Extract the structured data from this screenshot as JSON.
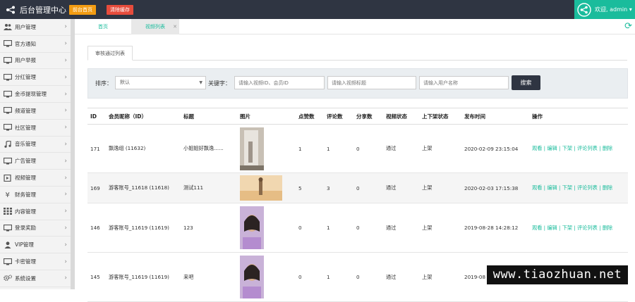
{
  "header": {
    "brand": "后台管理中心",
    "btn_home": "前台首页",
    "btn_cache": "清除缓存",
    "welcome": "欢迎, admin ▾"
  },
  "sidebar": {
    "items": [
      {
        "label": "用户管理",
        "icon": "users-icon"
      },
      {
        "label": "官方通知",
        "icon": "monitor-icon"
      },
      {
        "label": "用户举报",
        "icon": "monitor-icon"
      },
      {
        "label": "分红管理",
        "icon": "monitor-icon"
      },
      {
        "label": "金币提现管理",
        "icon": "monitor-icon"
      },
      {
        "label": "频道管理",
        "icon": "monitor-icon"
      },
      {
        "label": "社区管理",
        "icon": "monitor-icon"
      },
      {
        "label": "音乐管理",
        "icon": "music-icon"
      },
      {
        "label": "广告管理",
        "icon": "monitor-icon"
      },
      {
        "label": "视频管理",
        "icon": "video-icon"
      },
      {
        "label": "财务管理",
        "icon": "yen-icon"
      },
      {
        "label": "内容管理",
        "icon": "grid-icon"
      },
      {
        "label": "登录奖励",
        "icon": "monitor-icon"
      },
      {
        "label": "VIP管理",
        "icon": "user-icon"
      },
      {
        "label": "卡密管理",
        "icon": "monitor-icon"
      },
      {
        "label": "系统设置",
        "icon": "gears-icon"
      }
    ]
  },
  "tabs": {
    "home": "首页",
    "video_list": "视频列表"
  },
  "subtab": "审核通过列表",
  "filter": {
    "sort_label": "排序：",
    "sort_value": "默认",
    "keyword_label": "关键字：",
    "ph_id": "请输入视频ID、会员ID",
    "ph_title": "请输入视频标题",
    "ph_user": "请输入用户名称",
    "search": "搜索"
  },
  "table": {
    "headers": [
      "ID",
      "会员昵称（ID）",
      "标题",
      "图片",
      "点赞数",
      "评论数",
      "分享数",
      "视频状态",
      "上下架状态",
      "发布时间",
      "操作"
    ],
    "ops": "观看 | 编辑 | 下架 | 评论列表 | 删除",
    "rows": [
      {
        "id": "171",
        "member": "飘逸组 (11632)",
        "title": "小姐姐好飘逸......",
        "likes": "1",
        "comments": "1",
        "shares": "0",
        "status": "通过",
        "shelf": "上架",
        "time": "2020-02-09 23:15:04"
      },
      {
        "id": "169",
        "member": "游客账号_11618 (11618)",
        "title": "测试111",
        "likes": "5",
        "comments": "3",
        "shares": "0",
        "status": "通过",
        "shelf": "上架",
        "time": "2020-02-03 17:15:38"
      },
      {
        "id": "146",
        "member": "游客账号_11619 (11619)",
        "title": "123",
        "likes": "0",
        "comments": "1",
        "shares": "0",
        "status": "通过",
        "shelf": "上架",
        "time": "2019-08-28 14:28:12"
      },
      {
        "id": "145",
        "member": "游客账号_11619 (11619)",
        "title": "来吧",
        "likes": "0",
        "comments": "1",
        "shares": "0",
        "status": "通过",
        "shelf": "上架",
        "time": "2019-08"
      }
    ]
  },
  "watermark": "www.tiaozhuan.net",
  "colors": {
    "accent": "#1abc9c",
    "topbar": "#2f3542",
    "orange": "#f39c12",
    "red": "#e74c3c"
  }
}
